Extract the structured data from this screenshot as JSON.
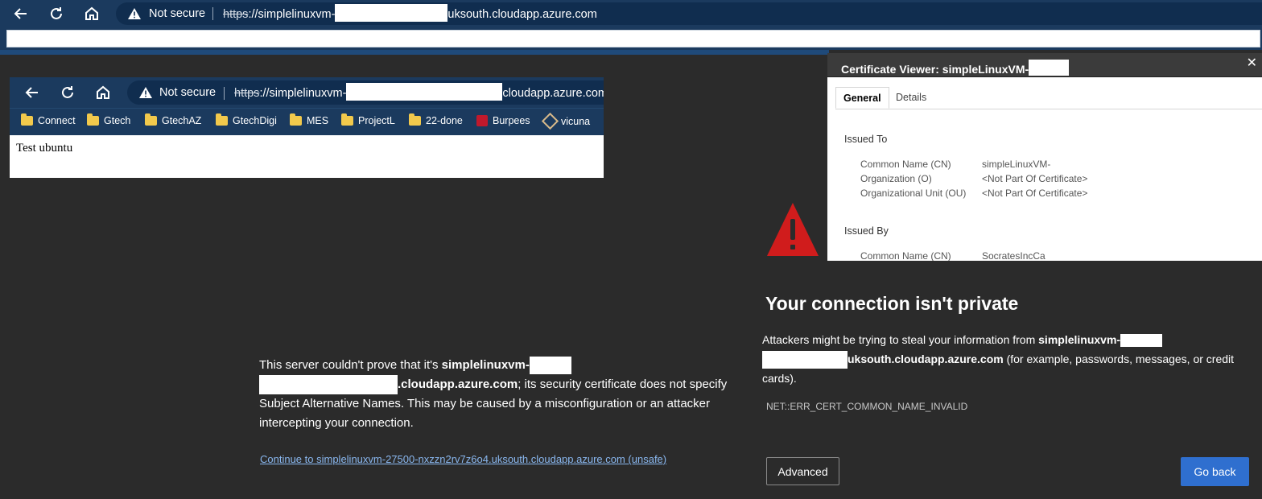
{
  "top_bar": {
    "not_secure": "Not secure",
    "url_scheme": "https",
    "url_prefix": "://simplelinuxvm-",
    "url_suffix": "uksouth.cloudapp.azure.com"
  },
  "inner_browser": {
    "not_secure": "Not secure",
    "url_scheme": "https",
    "url_prefix": "://simplelinuxvm-",
    "url_suffix": "cloudapp.azure.com",
    "bookmarks": [
      "Connect",
      "Gtech",
      "GtechAZ",
      "GtechDigi",
      "MES",
      "ProjectL",
      "22-done",
      "Burpees",
      "vicuna"
    ],
    "page_text": "Test ubuntu"
  },
  "cert_viewer": {
    "title": "Certificate Viewer: simpleLinuxVM-",
    "close": "✕",
    "tabs": [
      "General",
      "Details"
    ],
    "issued_to": {
      "heading": "Issued To",
      "rows": [
        {
          "label": "Common Name (CN)",
          "value": "simpleLinuxVM-"
        },
        {
          "label": "Organization (O)",
          "value": "<Not Part Of Certificate>"
        },
        {
          "label": "Organizational Unit (OU)",
          "value": "<Not Part Of Certificate>"
        }
      ]
    },
    "issued_by": {
      "heading": "Issued By",
      "rows": [
        {
          "label": "Common Name (CN)",
          "value": "SocratesIncCa"
        }
      ]
    }
  },
  "warning": {
    "title": "Your connection isn't private",
    "desc_prefix": "Attackers might be trying to steal your information from ",
    "desc_host_a": "simplelinuxvm-",
    "desc_host_b": "uksouth.cloudapp.azure.com",
    "desc_suffix": " (for example, passwords, messages, or credit cards).",
    "error_code": "NET::ERR_CERT_COMMON_NAME_INVALID",
    "advanced_label": "Advanced",
    "go_back_label": "Go back",
    "advanced_text_prefix": "This server couldn't prove that it's ",
    "advanced_host_a": "simplelinuxvm-",
    "advanced_host_b": ".cloudapp.azure.com",
    "advanced_text_suffix": "; its security certificate does not specify Subject Alternative Names. This may be caused by a misconfiguration or an attacker intercepting your connection.",
    "continue_link": "Continue to simplelinuxvm-27500-nxzzn2rv7z6o4.uksouth.cloudapp.azure.com (unsafe)"
  },
  "colors": {
    "page_bg": "#2b2b2b",
    "toolbar_bg": "#1b3a5e",
    "address_bg": "#102d4f",
    "warning_red": "#d01c1c",
    "primary_button": "#2f6fcf",
    "link": "#8ab8f0"
  },
  "icons": [
    "back-icon",
    "refresh-icon",
    "home-icon",
    "warning-icon",
    "folder-icon",
    "close-icon"
  ]
}
